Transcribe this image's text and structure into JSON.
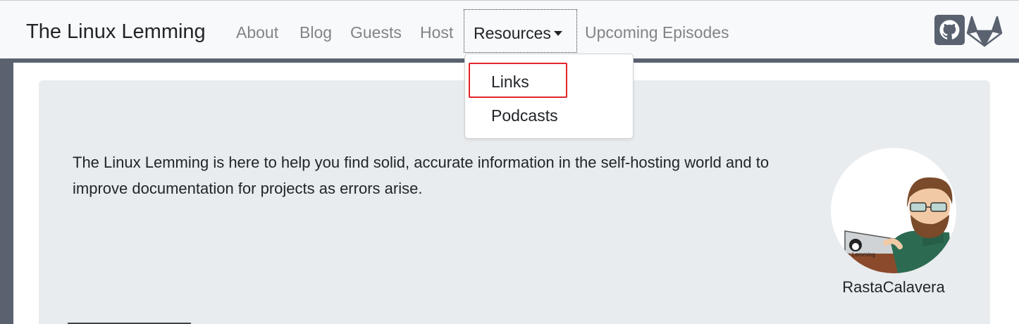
{
  "navbar": {
    "brand": "The Linux Lemming",
    "links": [
      "About",
      "Blog",
      "Guests",
      "Host"
    ],
    "resources_label": "Resources",
    "upcoming_label": "Upcoming Episodes",
    "icons": [
      "github-icon",
      "gitlab-icon"
    ]
  },
  "dropdown": {
    "items": [
      "Links",
      "Podcasts"
    ],
    "highlighted_item": "Links",
    "highlight_color": "#e3242b"
  },
  "jumbotron": {
    "intro": "The Linux Lemming is here to help you find solid, accurate information in the self-hosting world and to improve documentation for projects as errors arise.",
    "avatar_name": "RastaCalavera",
    "laptop_sticker_text": "ix Lemming"
  },
  "colors": {
    "navbar_bg": "#f8f9fa",
    "jumbotron_bg": "#e9ecef",
    "frame": "#5a6270",
    "muted_link": "#808489"
  }
}
